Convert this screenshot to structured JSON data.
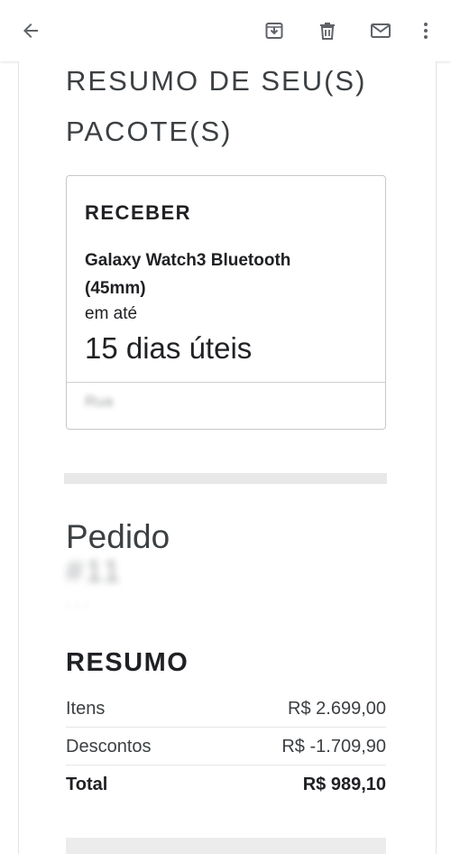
{
  "email": {
    "section_title_line1": "RESUMO DE SEU(S)",
    "section_title_line2": "PACOTE(S)",
    "package": {
      "label": "RECEBER",
      "product": "Galaxy Watch3 Bluetooth (45mm)",
      "until_label": "em até",
      "delivery_time": "15 dias úteis",
      "address_obscured": "Rua"
    },
    "order": {
      "label": "Pedido",
      "number_obscured": "#11"
    },
    "summary": {
      "title": "RESUMO",
      "rows": [
        {
          "label": "Itens",
          "value": "R$ 2.699,00"
        },
        {
          "label": "Descontos",
          "value": "R$ -1.709,90"
        },
        {
          "label": "Total",
          "value": "R$ 989,10"
        }
      ]
    }
  },
  "toolbar": {
    "icons": [
      "back-arrow-icon",
      "archive-icon",
      "delete-icon",
      "mark-unread-icon",
      "more-vert-icon"
    ]
  }
}
